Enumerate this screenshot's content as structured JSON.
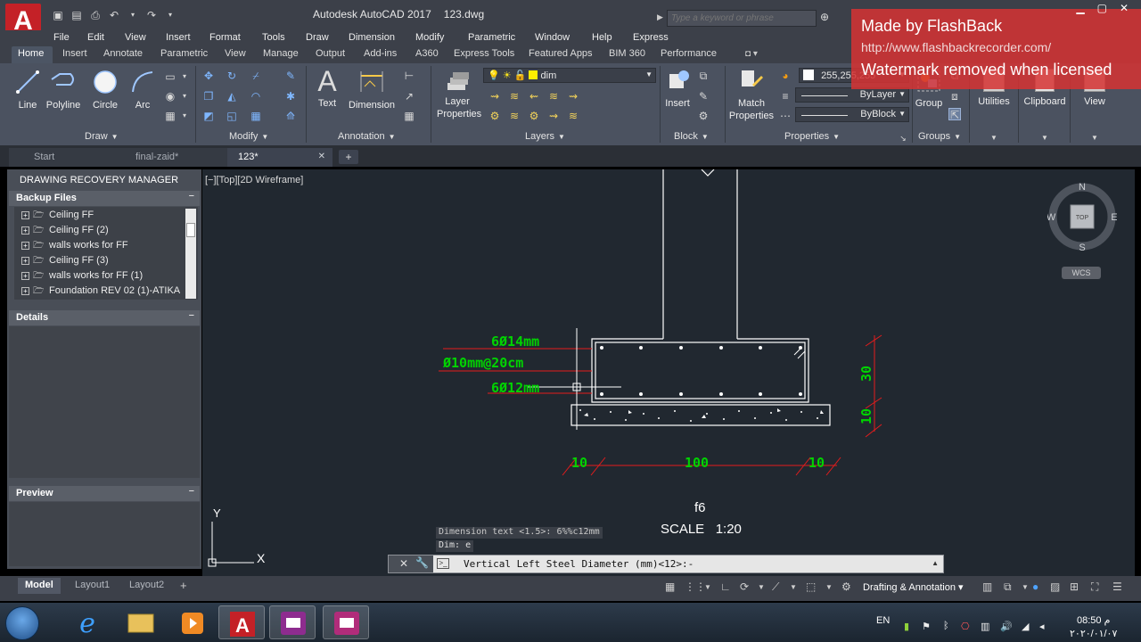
{
  "titlebar": {
    "app_logo": "A",
    "title": "Autodesk AutoCAD 2017",
    "file": "123.dwg",
    "search_placeholder": "Type a keyword or phrase"
  },
  "watermark": {
    "line1": "Made by FlashBack",
    "line2": "http://www.flashbackrecorder.com/",
    "line3": "Watermark removed when licensed"
  },
  "menubar": [
    "File",
    "Edit",
    "View",
    "Insert",
    "Format",
    "Tools",
    "Draw",
    "Dimension",
    "Modify",
    "Parametric",
    "Window",
    "Help",
    "Express"
  ],
  "ribbon_tabs": [
    "Home",
    "Insert",
    "Annotate",
    "Parametric",
    "View",
    "Manage",
    "Output",
    "Add-ins",
    "A360",
    "Express Tools",
    "Featured Apps",
    "BIM 360",
    "Performance"
  ],
  "ribbon": {
    "draw": {
      "label": "Draw",
      "tools": [
        "Line",
        "Polyline",
        "Circle",
        "Arc"
      ]
    },
    "modify": {
      "label": "Modify"
    },
    "annotation": {
      "label": "Annotation",
      "tools": [
        "Text",
        "Dimension"
      ]
    },
    "layers": {
      "label": "Layers",
      "tool": "Layer",
      "tool2": "Properties",
      "current_layer": "dim"
    },
    "block": {
      "label": "Block",
      "tool": "Insert"
    },
    "properties": {
      "label": "Properties",
      "tool": "Match",
      "tool2": "Properties",
      "color": "255,255,255",
      "linetype": "ByLayer",
      "lineweight": "ByBlock"
    },
    "groups": {
      "label": "Groups",
      "tool": "Group"
    },
    "utilities": {
      "label": "Utilities"
    },
    "clipboard": {
      "label": "Clipboard"
    },
    "view": {
      "label": "View"
    }
  },
  "file_tabs": [
    "Start",
    "final-zaid*",
    "123*"
  ],
  "recovery": {
    "title": "DRAWING RECOVERY MANAGER",
    "backup_header": "Backup Files",
    "files": [
      "Ceiling FF",
      "Ceiling FF (2)",
      "walls works for FF",
      "Ceiling FF (3)",
      "walls works for FF (1)",
      "Foundation REV 02 (1)-ATIKA"
    ],
    "details_header": "Details",
    "preview_header": "Preview"
  },
  "canvas": {
    "viewport_label": "[−][Top][2D Wireframe]",
    "rebar_top": "6Ø14mm",
    "stirrup": "Ø10mm@20cm",
    "rebar_bottom": "6Ø12mm",
    "dim_depth": "30",
    "dim_base": "10",
    "dim_left": "10",
    "dim_mid": "100",
    "dim_right": "10",
    "footing_name": "f6",
    "scale_text": "SCALE   1:20",
    "ucs_x": "X",
    "ucs_y": "Y"
  },
  "viewcube": {
    "n": "N",
    "s": "S",
    "e": "E",
    "w": "W",
    "top": "TOP",
    "wcs": "WCS"
  },
  "command": {
    "history1": "Dimension text <1.5>: 6%%c12mm",
    "history2": "Dim: e",
    "prompt": "Vertical Left Steel Diameter (mm)<12>:-"
  },
  "layout_tabs": [
    "Model",
    "Layout1",
    "Layout2"
  ],
  "statusbar": {
    "workspace": "Drafting & Annotation"
  },
  "tray": {
    "lang": "EN",
    "time": "08:50 م",
    "date": "٢٠٢٠/٠١/٠٧"
  },
  "colors": {
    "canvas_bg": "#212830",
    "cad_green": "#00d300",
    "cad_red": "#e51c1c",
    "cad_white": "#ffffff",
    "watermark_red": "#d63333"
  }
}
